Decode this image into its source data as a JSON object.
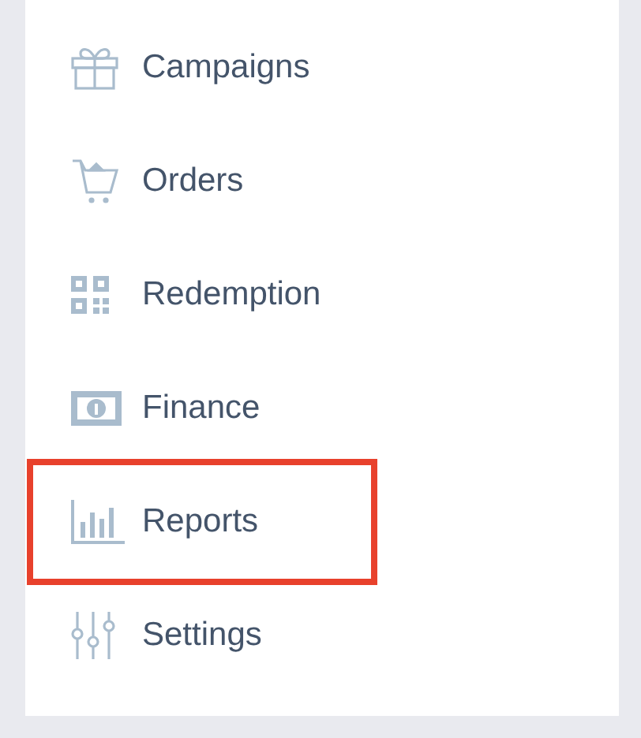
{
  "sidebar": {
    "items": [
      {
        "label": "Campaigns",
        "highlighted": false
      },
      {
        "label": "Orders",
        "highlighted": false
      },
      {
        "label": "Redemption",
        "highlighted": false
      },
      {
        "label": "Finance",
        "highlighted": false
      },
      {
        "label": "Reports",
        "highlighted": true
      },
      {
        "label": "Settings",
        "highlighted": false
      }
    ]
  }
}
